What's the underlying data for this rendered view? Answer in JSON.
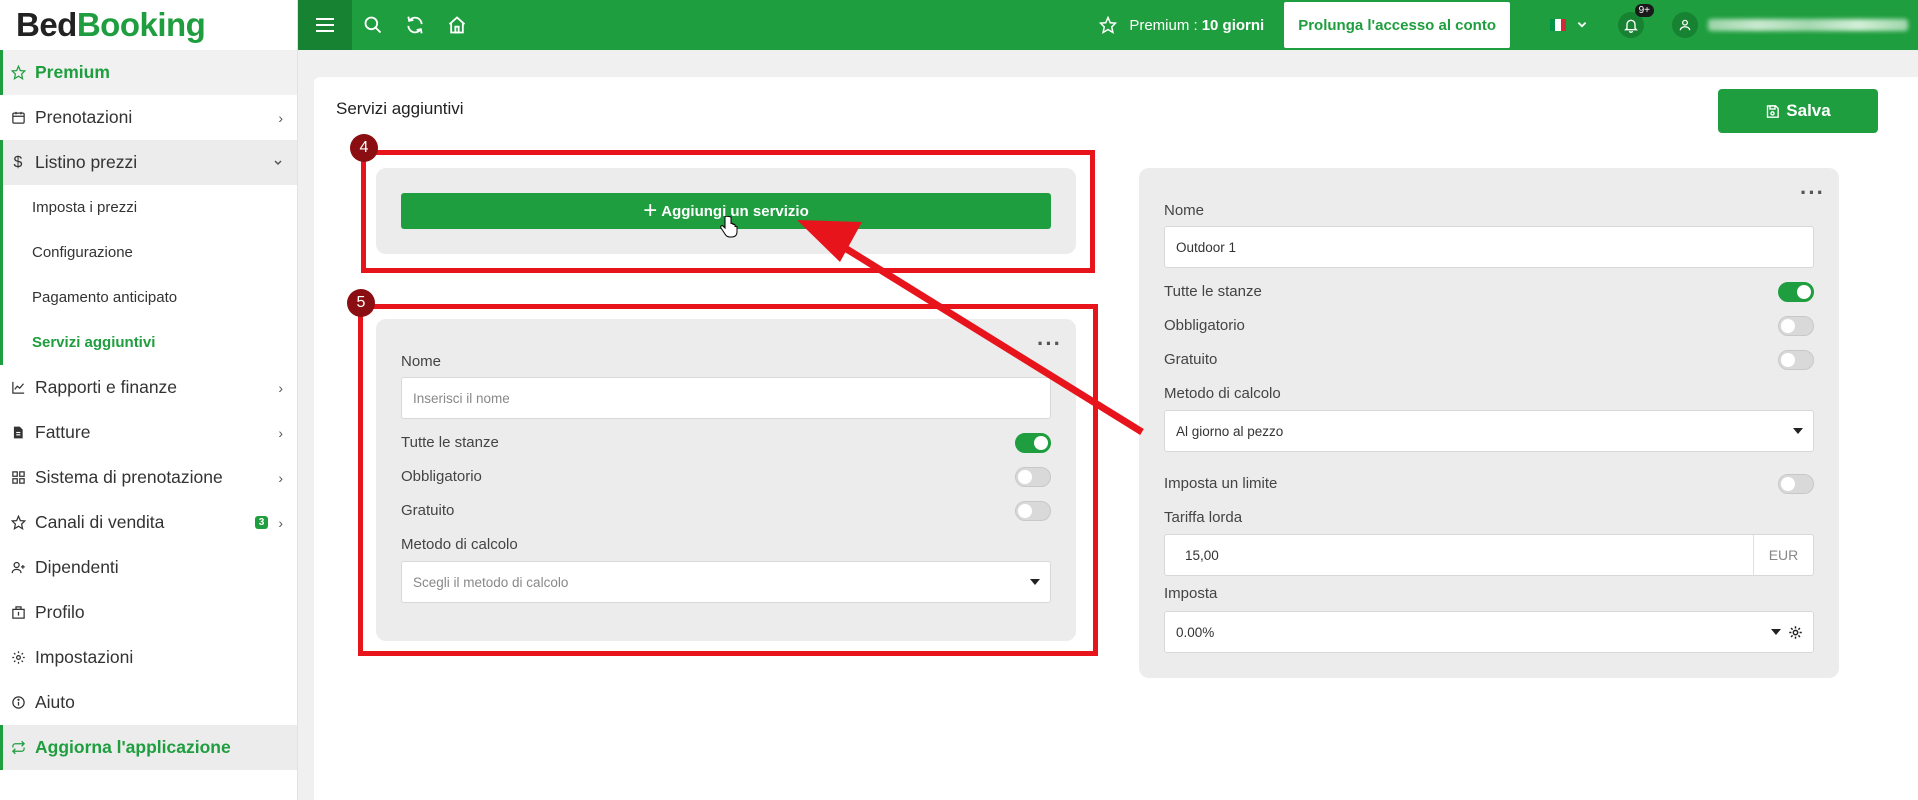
{
  "logo": {
    "part1": "Bed",
    "part2": "Booking"
  },
  "sidebar": {
    "premium": "Premium",
    "items": [
      {
        "label": "Prenotazioni"
      },
      {
        "label": "Listino prezzi"
      },
      {
        "label": "Rapporti e finanze"
      },
      {
        "label": "Fatture"
      },
      {
        "label": "Sistema di prenotazione"
      },
      {
        "label": "Canali di vendita",
        "badge": "3"
      },
      {
        "label": "Dipendenti"
      },
      {
        "label": "Profilo"
      },
      {
        "label": "Impostazioni"
      },
      {
        "label": "Aiuto"
      }
    ],
    "sub_items": [
      {
        "label": "Imposta i prezzi"
      },
      {
        "label": "Configurazione"
      },
      {
        "label": "Pagamento anticipato"
      },
      {
        "label": "Servizi aggiuntivi"
      }
    ],
    "update": "Aggiorna l'applicazione"
  },
  "topbar": {
    "premium_label": "Premium :",
    "premium_days": "10 giorni",
    "extend_button": "Prolunga l'accesso al conto",
    "notification_count": "9+"
  },
  "page": {
    "title": "Servizi aggiuntivi",
    "save_button": "Salva",
    "add_button": "Aggiungi un servizio"
  },
  "new_service": {
    "name_label": "Nome",
    "name_placeholder": "Inserisci il nome",
    "all_rooms_label": "Tutte le stanze",
    "all_rooms_on": true,
    "mandatory_label": "Obbligatorio",
    "mandatory_on": false,
    "free_label": "Gratuito",
    "free_on": false,
    "method_label": "Metodo di calcolo",
    "method_placeholder": "Scegli il metodo di calcolo"
  },
  "existing_service": {
    "name_label": "Nome",
    "name_value": "Outdoor 1",
    "all_rooms_label": "Tutte le stanze",
    "all_rooms_on": true,
    "mandatory_label": "Obbligatorio",
    "mandatory_on": false,
    "free_label": "Gratuito",
    "free_on": false,
    "method_label": "Metodo di calcolo",
    "method_value": "Al giorno al pezzo",
    "limit_label": "Imposta un limite",
    "limit_on": false,
    "gross_rate_label": "Tariffa lorda",
    "gross_rate_value": "15,00",
    "currency": "EUR",
    "tax_label": "Imposta",
    "tax_value": "0.00%"
  },
  "annotations": {
    "step_a": "4",
    "step_b": "5"
  },
  "colors": {
    "brand": "#1e9e3e",
    "annotation": "#e8141c",
    "annotation_badge": "#8b0f12"
  }
}
